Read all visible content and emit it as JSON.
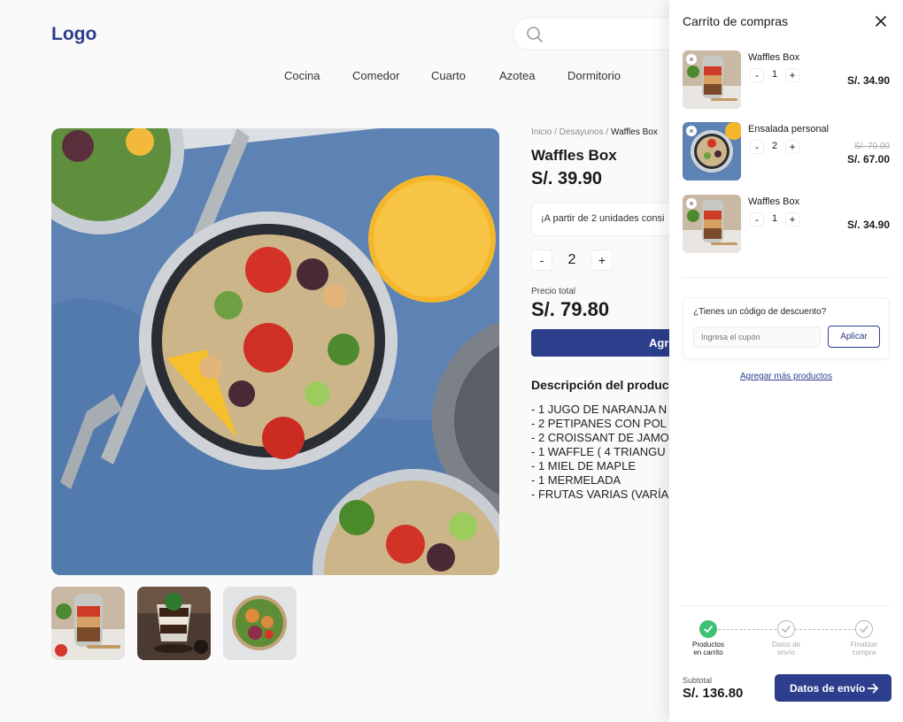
{
  "brand": {
    "logo": "Logo"
  },
  "search": {
    "placeholder": ""
  },
  "nav": [
    "Cocina",
    "Comedor",
    "Cuarto",
    "Azotea",
    "Dormitorio"
  ],
  "product": {
    "breadcrumb": {
      "path": "Inicio / Desayunos / ",
      "current": "Waffles Box"
    },
    "title": "Waffles Box",
    "price": "S/. 39.90",
    "promo": "¡A partir de 2 unidades consi",
    "qty": {
      "minus": "-",
      "value": "2",
      "plus": "+"
    },
    "total_label": "Precio total",
    "total_value": "S/. 79.80",
    "add_label": "Agre",
    "description_title": "Descripción del producto",
    "description_lines": [
      "- 1 JUGO DE NARANJA N",
      "- 2 PETIPANES CON POL",
      "- 2 CROISSANT DE JAMO",
      "- 1 WAFFLE ( 4 TRIANGU",
      "- 1 MIEL DE MAPLE",
      "- 1 MERMELADA",
      "- FRUTAS VARIAS (VARÍA"
    ]
  },
  "cart": {
    "title": "Carrito de compras",
    "items": [
      {
        "name": "Waffles Box",
        "qty": "1",
        "old_price": "",
        "price": "S/. 34.90",
        "remove": "×",
        "minus": "-",
        "plus": "+"
      },
      {
        "name": "Ensalada personal",
        "qty": "2",
        "old_price": "S/. 70.00",
        "price": "S/. 67.00",
        "remove": "×",
        "minus": "-",
        "plus": "+"
      },
      {
        "name": "Waffles Box",
        "qty": "1",
        "old_price": "",
        "price": "S/. 34.90",
        "remove": "×",
        "minus": "-",
        "plus": "+"
      }
    ],
    "coupon": {
      "question": "¿Tienes un código de descuento?",
      "placeholder": "Ingresa el cupón",
      "apply": "Aplicar"
    },
    "more_link": "Agregar más productos",
    "steps": [
      {
        "line1": "Productos",
        "line2": "en carrito",
        "status": "done"
      },
      {
        "line1": "Datos de",
        "line2": "envío",
        "status": "todo"
      },
      {
        "line1": "Finalizar",
        "line2": "compra",
        "status": "todo"
      }
    ],
    "subtotal_label": "Subtotal",
    "subtotal_value": "S/. 136.80",
    "next_button": "Datos de envío"
  },
  "colors": {
    "brand": "#2c3e8c",
    "success": "#3cc274",
    "muted": "#aaaaaa"
  },
  "icons": [
    "search-icon",
    "close-icon",
    "check-icon",
    "arrow-right-icon"
  ]
}
